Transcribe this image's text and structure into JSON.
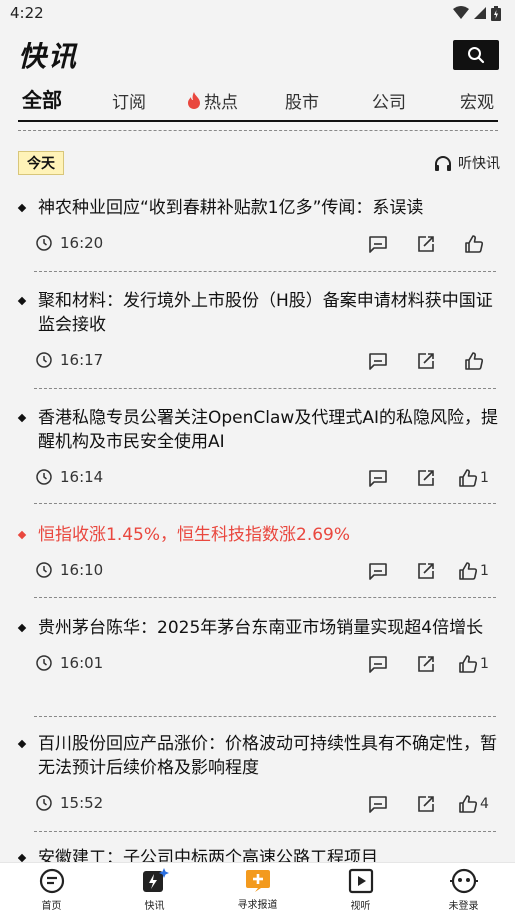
{
  "status_bar": {
    "time": "4:22"
  },
  "header": {
    "title": "快讯"
  },
  "tabs": [
    {
      "label": "全部",
      "active": true
    },
    {
      "label": "订阅"
    },
    {
      "label": "热点",
      "hot": true
    },
    {
      "label": "股市"
    },
    {
      "label": "公司"
    },
    {
      "label": "宏观"
    }
  ],
  "today_label": "今天",
  "listen_label": "听快讯",
  "news": [
    {
      "title": "神农种业回应“收到春耕补贴款1亿多”传闻：系误读",
      "time": "16:20",
      "likes": "",
      "highlight": false
    },
    {
      "title": "聚和材料：发行境外上市股份（H股）备案申请材料获中国证监会接收",
      "time": "16:17",
      "likes": "",
      "highlight": false
    },
    {
      "title": "香港私隐专员公署关注OpenClaw及代理式AI的私隐风险，提醒机构及市民安全使用AI",
      "time": "16:14",
      "likes": "1",
      "highlight": false
    },
    {
      "title": "恒指收涨1.45%，恒生科技指数涨2.69%",
      "time": "16:10",
      "likes": "1",
      "highlight": true
    },
    {
      "title": "贵州茅台陈华：2025年茅台东南亚市场销量实现超4倍增长",
      "time": "16:01",
      "likes": "1",
      "highlight": false
    },
    {
      "title": "百川股份回应产品涨价：价格波动可持续性具有不确定性，暂无法预计后续价格及影响程度",
      "time": "15:52",
      "likes": "4",
      "highlight": false
    },
    {
      "title": "安徽建工：子公司中标两个高速公路工程项目",
      "time": "",
      "likes": "",
      "highlight": false
    }
  ],
  "bottom_nav": [
    {
      "label": "首页",
      "icon": "home-icon"
    },
    {
      "label": "快讯",
      "icon": "flash-icon",
      "active": true
    },
    {
      "label": "寻求报道",
      "icon": "report-icon"
    },
    {
      "label": "视听",
      "icon": "video-icon"
    },
    {
      "label": "未登录",
      "icon": "user-icon"
    }
  ],
  "colors": {
    "accent_red": "#e9473e",
    "background": "#f3f3f3",
    "report_orange": "#f39a1e"
  }
}
